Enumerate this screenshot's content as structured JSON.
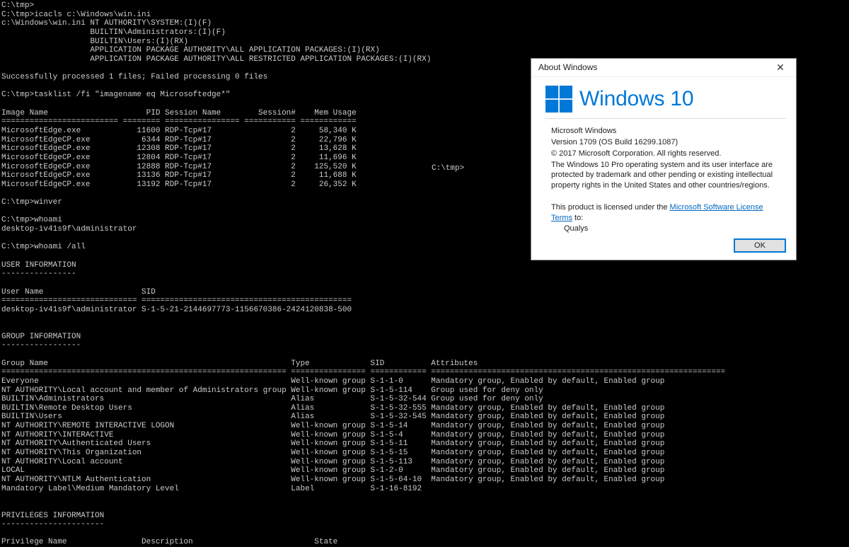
{
  "terminal_left": "C:\\tmp>\nC:\\tmp>icacls c:\\Windows\\win.ini\nc:\\Windows\\win.ini NT AUTHORITY\\SYSTEM:(I)(F)\n                   BUILTIN\\Administrators:(I)(F)\n                   BUILTIN\\Users:(I)(RX)\n                   APPLICATION PACKAGE AUTHORITY\\ALL APPLICATION PACKAGES:(I)(RX)\n                   APPLICATION PACKAGE AUTHORITY\\ALL RESTRICTED APPLICATION PACKAGES:(I)(RX)\n\nSuccessfully processed 1 files; Failed processing 0 files\n\nC:\\tmp>tasklist /fi \"imagename eq Microsoftedge*\"\n\nImage Name                     PID Session Name        Session#    Mem Usage\n========================= ======== ================ =========== ============\nMicrosoftEdge.exe            11600 RDP-Tcp#17                 2     58,340 K\nMicrosoftEdgeCP.exe           6344 RDP-Tcp#17                 2     22,796 K\nMicrosoftEdgeCP.exe          12308 RDP-Tcp#17                 2     13,628 K\nMicrosoftEdgeCP.exe          12804 RDP-Tcp#17                 2     11,696 K\nMicrosoftEdgeCP.exe          12888 RDP-Tcp#17                 2    125,520 K\nMicrosoftEdgeCP.exe          13136 RDP-Tcp#17                 2     11,688 K\nMicrosoftEdgeCP.exe          13192 RDP-Tcp#17                 2     26,352 K\n\nC:\\tmp>winver\n\nC:\\tmp>whoami\ndesktop-iv41s9f\\administrator\n\nC:\\tmp>whoami /all\n\nUSER INFORMATION\n----------------\n\nUser Name                     SID\n============================= =============================================\ndesktop-iv41s9f\\administrator S-1-5-21-2144697773-1156670386-2424120838-500\n\n\nGROUP INFORMATION\n-----------------\n\nGroup Name                                                    Type             SID          Attributes\n============================================================= ================ ============ ===============================================================\nEveryone                                                      Well-known group S-1-1-0      Mandatory group, Enabled by default, Enabled group\nNT AUTHORITY\\Local account and member of Administrators group Well-known group S-1-5-114    Group used for deny only\nBUILTIN\\Administrators                                        Alias            S-1-5-32-544 Group used for deny only\nBUILTIN\\Remote Desktop Users                                  Alias            S-1-5-32-555 Mandatory group, Enabled by default, Enabled group\nBUILTIN\\Users                                                 Alias            S-1-5-32-545 Mandatory group, Enabled by default, Enabled group\nNT AUTHORITY\\REMOTE INTERACTIVE LOGON                         Well-known group S-1-5-14     Mandatory group, Enabled by default, Enabled group\nNT AUTHORITY\\INTERACTIVE                                      Well-known group S-1-5-4      Mandatory group, Enabled by default, Enabled group\nNT AUTHORITY\\Authenticated Users                              Well-known group S-1-5-11     Mandatory group, Enabled by default, Enabled group\nNT AUTHORITY\\This Organization                                Well-known group S-1-5-15     Mandatory group, Enabled by default, Enabled group\nNT AUTHORITY\\Local account                                    Well-known group S-1-5-113    Mandatory group, Enabled by default, Enabled group\nLOCAL                                                         Well-known group S-1-2-0      Mandatory group, Enabled by default, Enabled group\nNT AUTHORITY\\NTLM Authentication                              Well-known group S-1-5-64-10  Mandatory group, Enabled by default, Enabled group\nMandatory Label\\Medium Mandatory Level                        Label            S-1-16-8192\n\n\nPRIVILEGES INFORMATION\n----------------------\n\nPrivilege Name                Description                          State",
  "terminal_right": "C:\\tmp>",
  "dialog": {
    "title": "About Windows",
    "brand": "Windows 10",
    "line1": "Microsoft Windows",
    "line2": "Version 1709 (OS Build 16299.1087)",
    "line3": "© 2017 Microsoft Corporation. All rights reserved.",
    "line4": "The Windows 10 Pro operating system and its user interface are protected by trademark and other pending or existing intellectual property rights in the United States and other countries/regions.",
    "lic_prefix": "This product is licensed under the ",
    "lic_link": "Microsoft Software License Terms",
    "lic_suffix": " to:",
    "licensee": "Qualys",
    "ok": "OK",
    "close": "✕"
  }
}
